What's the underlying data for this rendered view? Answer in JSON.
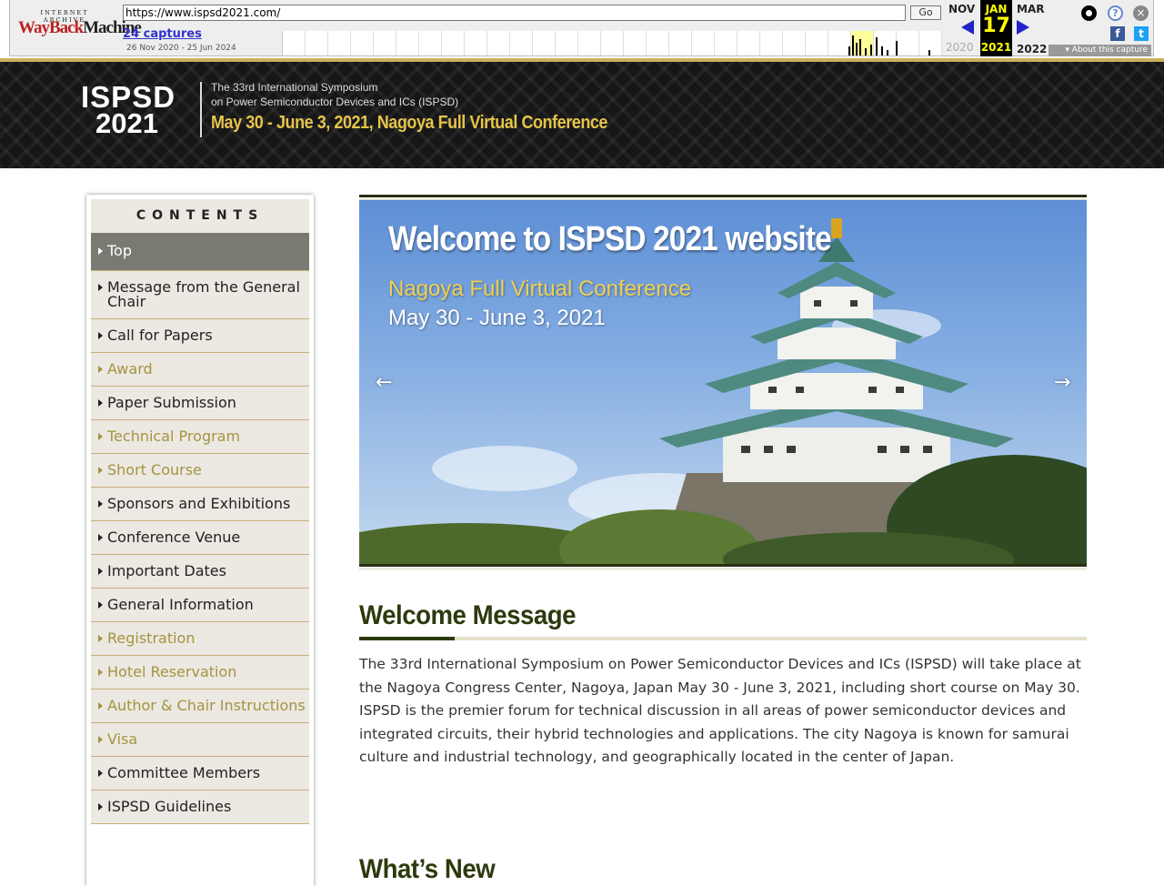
{
  "wayback": {
    "logo_top": "INTERNET ARCHIVE",
    "logo_part1": "WayBack",
    "logo_part2": "Machine",
    "url": "https://www.ispsd2021.com/",
    "go_label": "Go",
    "captures": "24 captures",
    "date_range": "26 Nov 2020 - 25 Jun 2024",
    "prev_month": "NOV",
    "prev_year": "2020",
    "cur_month": "JAN",
    "cur_day": "17",
    "cur_year": "2021",
    "next_month": "MAR",
    "next_year": "2022",
    "about": "About this capture",
    "icons": [
      "user-icon",
      "help-icon",
      "close-icon",
      "facebook-icon",
      "twitter-icon"
    ]
  },
  "header": {
    "brand_line1": "ISPSD",
    "brand_line2": "2021",
    "subtitle1": "The 33rd International Symposium",
    "subtitle2": "on Power Semiconductor Devices and ICs (ISPSD)",
    "tagline": "May 30 - June 3, 2021, Nagoya Full Virtual Conference"
  },
  "sidebar": {
    "title": "CONTENTS",
    "items": [
      {
        "label": "Top",
        "state": "active"
      },
      {
        "label": "Message from the General Chair",
        "state": "normal"
      },
      {
        "label": "Call for Papers",
        "state": "normal"
      },
      {
        "label": "Award",
        "state": "dim"
      },
      {
        "label": "Paper Submission",
        "state": "normal"
      },
      {
        "label": "Technical Program",
        "state": "dim"
      },
      {
        "label": "Short Course",
        "state": "dim"
      },
      {
        "label": "Sponsors and Exhibitions",
        "state": "normal"
      },
      {
        "label": "Conference Venue",
        "state": "normal"
      },
      {
        "label": "Important Dates",
        "state": "normal"
      },
      {
        "label": "General Information",
        "state": "normal"
      },
      {
        "label": "Registration",
        "state": "dim"
      },
      {
        "label": "Hotel Reservation",
        "state": "dim"
      },
      {
        "label": "Author & Chair Instructions",
        "state": "dim"
      },
      {
        "label": "Visa",
        "state": "dim"
      },
      {
        "label": "Committee Members",
        "state": "normal"
      },
      {
        "label": "ISPSD Guidelines",
        "state": "normal"
      }
    ]
  },
  "hero": {
    "title": "Welcome to ISPSD 2021 website",
    "subtitle": "Nagoya Full Virtual Conference",
    "dates": "May 30 - June 3, 2021",
    "prev": "←",
    "next": "→"
  },
  "welcome": {
    "heading": "Welcome Message",
    "para1": "The 33rd International Symposium on Power Semiconductor Devices and ICs (ISPSD) will take place at the Nagoya Congress Center, Nagoya, Japan May 30 - June 3, 2021, including short course on May 30.",
    "para2": "ISPSD is the premier forum for technical discussion in all areas of power semiconductor devices and integrated circuits, their hybrid technologies and applications. The city Nagoya is known for samurai culture and industrial technology, and geographically located in the center of Japan."
  },
  "whats_new": {
    "heading": "What’s New"
  },
  "colors": {
    "gold": "#c9b25e",
    "heading_green": "#2d3a0e",
    "dim_link": "#a39440",
    "active_bg": "#7a7a72"
  }
}
